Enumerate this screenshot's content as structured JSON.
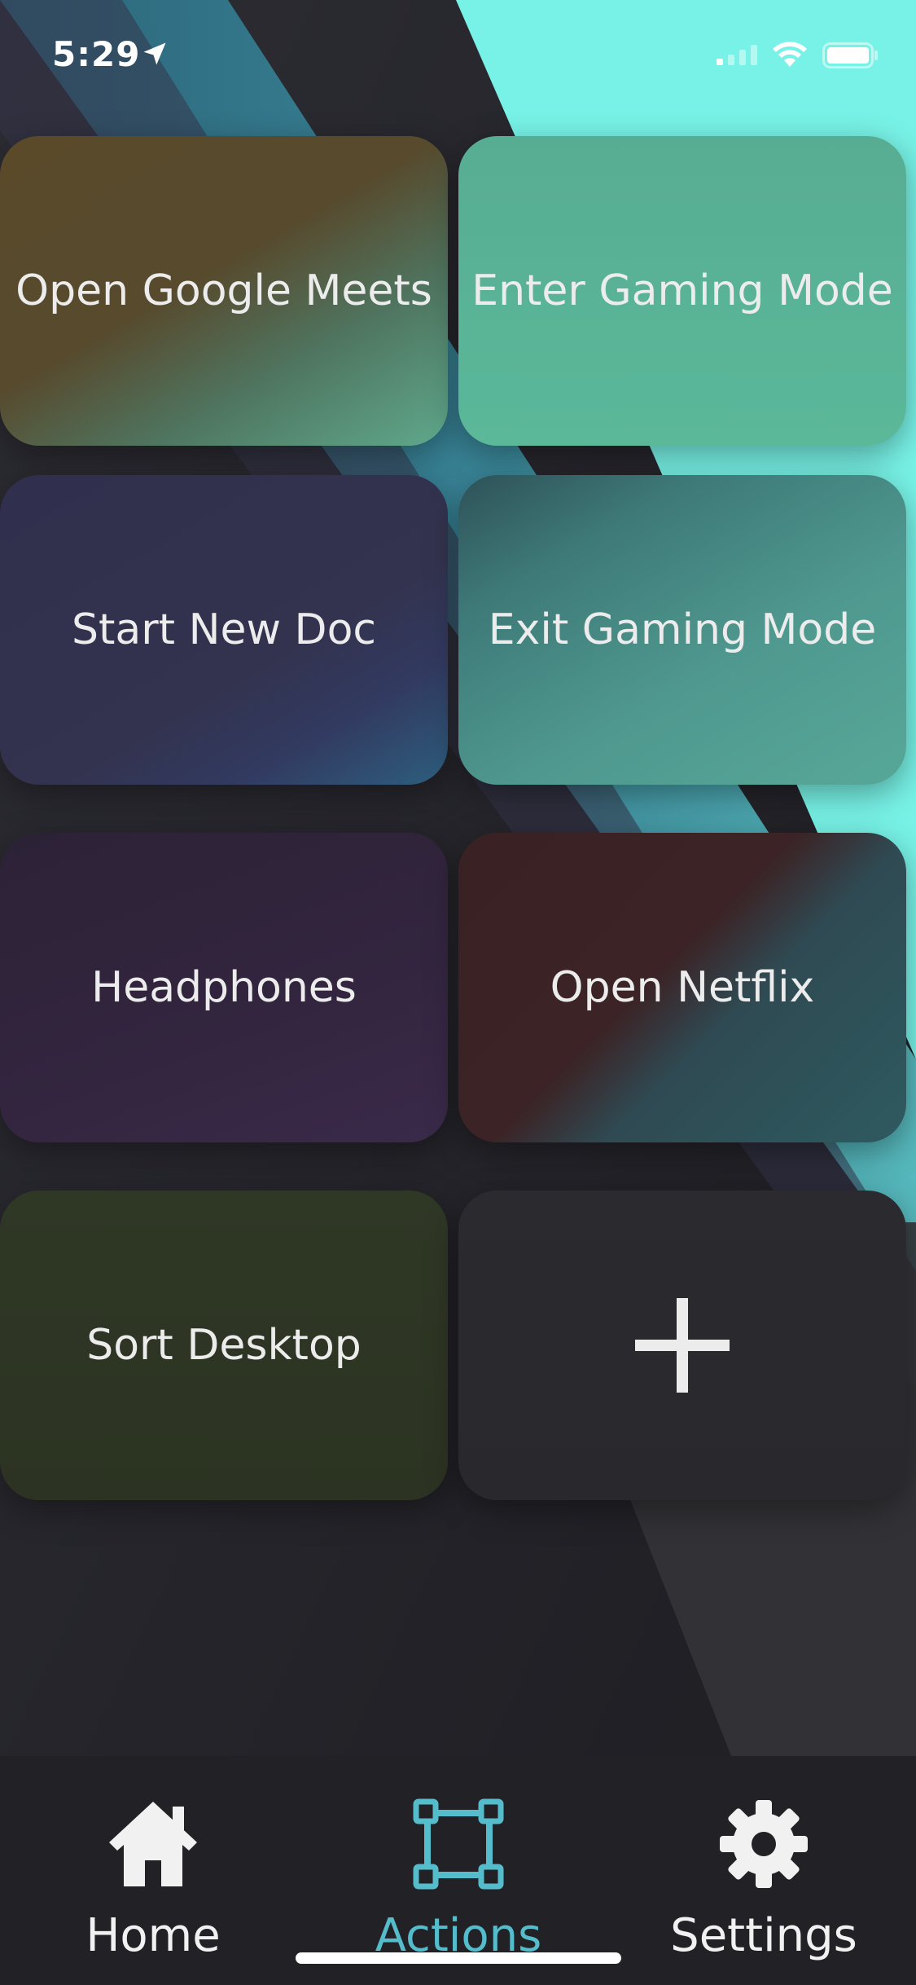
{
  "status_bar": {
    "time": "5:29",
    "icons": [
      "location-arrow-icon",
      "cellular-signal-icon",
      "wifi-icon",
      "battery-icon"
    ]
  },
  "actions": [
    {
      "label": "Open Google Meets"
    },
    {
      "label": "Enter Gaming Mode"
    },
    {
      "label": "Start New Doc"
    },
    {
      "label": "Exit Gaming Mode"
    },
    {
      "label": "Headphones"
    },
    {
      "label": "Open Netflix"
    },
    {
      "label": "Sort Desktop"
    }
  ],
  "add_action": {
    "icon": "plus-icon"
  },
  "tabbar": {
    "active": "Actions",
    "accent_color": "#55bccb",
    "items": [
      {
        "label": "Home",
        "icon": "house-icon"
      },
      {
        "label": "Actions",
        "icon": "bounding-box-icon"
      },
      {
        "label": "Settings",
        "icon": "gear-icon"
      }
    ]
  }
}
